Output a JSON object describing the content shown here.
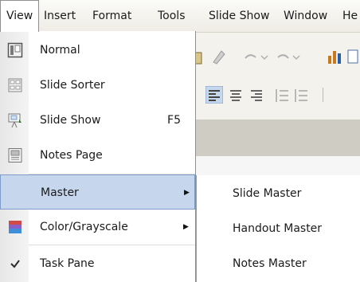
{
  "menubar": {
    "items": [
      {
        "label": "View",
        "active": true
      },
      {
        "label": "Insert"
      },
      {
        "label": "Format"
      },
      {
        "label": "Tools"
      },
      {
        "label": "Slide Show"
      },
      {
        "label": "Window"
      },
      {
        "label": "He"
      }
    ]
  },
  "view_menu": {
    "items": [
      {
        "label": "Normal",
        "icon": "normal-view-icon"
      },
      {
        "label": "Slide Sorter",
        "icon": "slide-sorter-icon"
      },
      {
        "label": "Slide Show",
        "shortcut": "F5",
        "icon": "slide-show-icon"
      },
      {
        "label": "Notes Page",
        "icon": "notes-page-icon"
      },
      {
        "label": "Master",
        "submenu": true,
        "highlighted": true
      },
      {
        "label": "Color/Grayscale",
        "submenu": true,
        "icon": "color-grayscale-icon"
      },
      {
        "label": "Task Pane",
        "checked": true,
        "icon": "checkmark-icon"
      }
    ]
  },
  "master_submenu": {
    "items": [
      {
        "label": "Slide Master"
      },
      {
        "label": "Handout Master"
      },
      {
        "label": "Notes Master"
      }
    ]
  },
  "colors": {
    "highlight": "#c6d6ec",
    "highlight_border": "#7d9ccc",
    "menubar_bg": "#f2f0ea"
  }
}
